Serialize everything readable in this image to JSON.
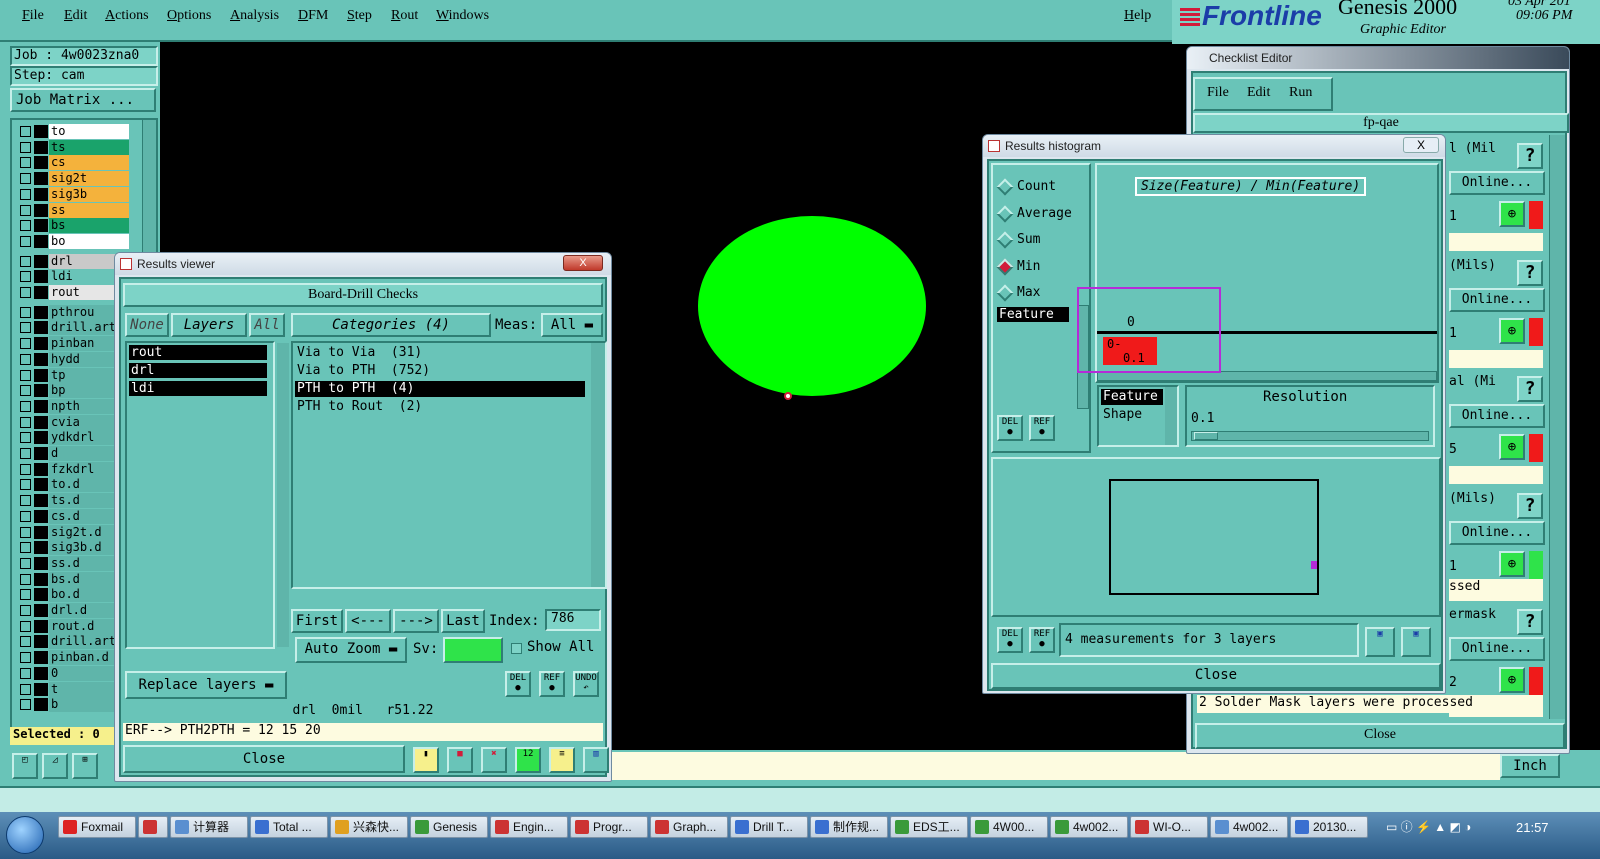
{
  "menubar": {
    "items": [
      "File",
      "Edit",
      "Actions",
      "Options",
      "Analysis",
      "DFM",
      "Step",
      "Rout",
      "Windows"
    ],
    "help": "Help"
  },
  "brand": {
    "logo": "Frontline",
    "product": "Genesis 2000",
    "subtitle": "Graphic Editor",
    "date": "03 Apr 201",
    "time": "09:06 PM"
  },
  "job": {
    "job_label": "Job : 4w0023zna0",
    "step_label": "Step: cam",
    "matrix_button": "Job Matrix ..."
  },
  "layers": {
    "group1": [
      {
        "name": "to",
        "color": "#ffffff"
      },
      {
        "name": "ts",
        "color": "#1aa36b"
      },
      {
        "name": "cs",
        "color": "#f4b23c"
      },
      {
        "name": "sig2t",
        "color": "#f4b23c"
      },
      {
        "name": "sig3b",
        "color": "#f4b23c"
      },
      {
        "name": "ss",
        "color": "#f4b23c"
      },
      {
        "name": "bs",
        "color": "#1aa36b"
      },
      {
        "name": "bo",
        "color": "#ffffff"
      }
    ],
    "group2": [
      {
        "name": "drl",
        "color": "#c9c9c9"
      },
      {
        "name": "ldi",
        "color": "#69c4b8"
      },
      {
        "name": "rout",
        "color": "#e6e6e6"
      }
    ],
    "group3": [
      "pthrou",
      "drill.art",
      "pinban",
      "hydd",
      "tp",
      "bp",
      "npth",
      "cvia",
      "ydkdrl",
      "d",
      "fzkdrl",
      "to.d",
      "ts.d",
      "cs.d",
      "sig2t.d",
      "sig3b.d",
      "ss.d",
      "bs.d",
      "bo.d",
      "drl.d",
      "rout.d",
      "drill.art",
      "pinban.d",
      "0",
      "t",
      "b"
    ],
    "selected": "Selected : 0"
  },
  "results_viewer": {
    "title": "Results viewer",
    "close_x": "X",
    "header": "Board-Drill Checks",
    "none_btn": "None",
    "layers_btn": "Layers",
    "all_btn": "All",
    "categories_btn": "Categories (4)",
    "meas_label": "Meas:",
    "meas_value": "All",
    "layer_list": [
      "rout",
      "drl",
      "ldi"
    ],
    "categories": [
      "Via to Via  (31)",
      "Via to PTH  (752)",
      "PTH to PTH  (4)",
      "PTH to Rout  (2)"
    ],
    "first": "First",
    "prev": "<---",
    "next": "--->",
    "last": "Last",
    "index_label": "Index:",
    "index_value": "786",
    "auto_zoom": "Auto Zoom",
    "sv_label": "Sv:",
    "show_all": "Show All",
    "replace_layers": "Replace layers",
    "status_line": "drl  0mil   r51.22",
    "erf_line": "ERF--> PTH2PTH = 12 15 20",
    "close": "Close",
    "icons": {
      "del": "DEL",
      "ref": "REF",
      "undo": "UNDO"
    }
  },
  "histogram": {
    "title": "Results histogram",
    "close_x": "X",
    "modes": [
      {
        "label": "Count",
        "on": false
      },
      {
        "label": "Average",
        "on": false
      },
      {
        "label": "Sum",
        "on": false
      },
      {
        "label": "Min",
        "on": true
      },
      {
        "label": "Max",
        "on": false
      }
    ],
    "feature_label": "Feature",
    "chart_title": "Size(Feature) / Min(Feature)",
    "zero_label": "0",
    "bin_label_top": "0-",
    "bin_label_bottom": "0.1",
    "list_items": [
      "Feature",
      "Shape"
    ],
    "resolution_label": "Resolution",
    "resolution_value": "0.1",
    "measure_text": "4 measurements for 3 layers",
    "close": "Close",
    "del": "DEL",
    "ref": "REF"
  },
  "checklist": {
    "title": "Checklist Editor",
    "menu": [
      "File",
      "Edit",
      "Run"
    ],
    "name": "fp-qae",
    "rows": [
      {
        "text": "l (Mil",
        "online": "Online...",
        "num": "1"
      },
      {
        "text": "(Mils)",
        "online": "Online...",
        "num": "1"
      },
      {
        "text": "al (Mi",
        "online": "Online...",
        "num": "5"
      },
      {
        "text": "(Mils)",
        "online": "Online...",
        "num": "1"
      },
      {
        "text": "ermask",
        "online": "Online...",
        "num": "2"
      }
    ],
    "ssed": "ssed",
    "message": "2 Solder Mask layers were processed",
    "close": "Close",
    "unit": "Inch"
  },
  "taskbar": {
    "items": [
      "Foxmail",
      "",
      "计算器",
      "Total ...",
      "兴森快...",
      "Genesis",
      "Engin...",
      "Progr...",
      "Graph...",
      "Drill T...",
      "制作规...",
      "EDS工...",
      "4W00...",
      "4w002...",
      "WI-O...",
      "4w002...",
      "20130..."
    ],
    "clock": "21:57"
  },
  "colors": {
    "canvas": "#000000",
    "feature": "#00ff00",
    "panel": "#69c4b8",
    "highlight": "#d21c3a",
    "accent": "#b52bd8"
  }
}
